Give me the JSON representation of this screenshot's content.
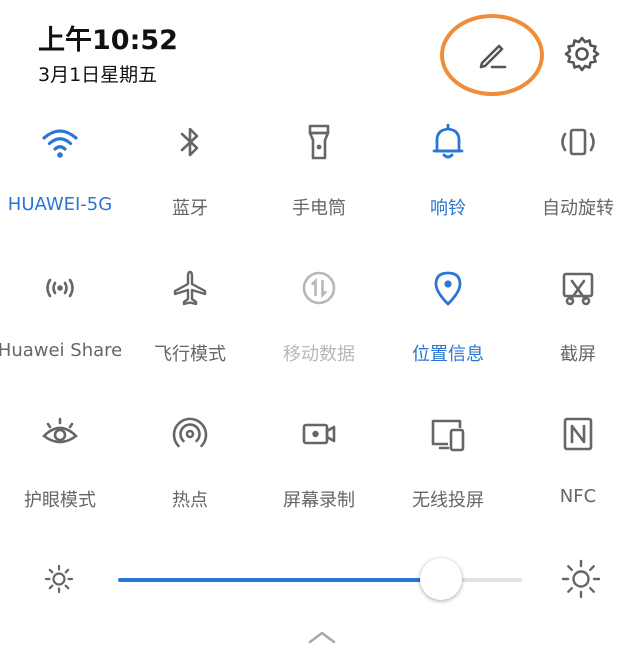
{
  "status": {
    "time": "上午10:52",
    "date": "3月1日星期五"
  },
  "colors": {
    "accent": "#2a76d2",
    "highlight": "#ef8d3b",
    "icon": "#666666",
    "disabled": "#b8b8b8"
  },
  "toggles": [
    {
      "label": "HUAWEI-5G",
      "icon": "wifi-icon",
      "state": "on"
    },
    {
      "label": "蓝牙",
      "icon": "bluetooth-icon",
      "state": "off"
    },
    {
      "label": "手电筒",
      "icon": "flashlight-icon",
      "state": "off"
    },
    {
      "label": "响铃",
      "icon": "bell-icon",
      "state": "on"
    },
    {
      "label": "自动旋转",
      "icon": "auto-rotate-icon",
      "state": "off"
    },
    {
      "label": "Huawei Share",
      "icon": "huawei-share-icon",
      "state": "off"
    },
    {
      "label": "飞行模式",
      "icon": "airplane-icon",
      "state": "off"
    },
    {
      "label": "移动数据",
      "icon": "mobile-data-icon",
      "state": "disabled"
    },
    {
      "label": "位置信息",
      "icon": "location-icon",
      "state": "on"
    },
    {
      "label": "截屏",
      "icon": "screenshot-icon",
      "state": "off"
    },
    {
      "label": "护眼模式",
      "icon": "eye-comfort-icon",
      "state": "off"
    },
    {
      "label": "热点",
      "icon": "hotspot-icon",
      "state": "off"
    },
    {
      "label": "屏幕录制",
      "icon": "screen-record-icon",
      "state": "off"
    },
    {
      "label": "无线投屏",
      "icon": "wireless-projection-icon",
      "state": "off"
    },
    {
      "label": "NFC",
      "icon": "nfc-icon",
      "state": "off"
    }
  ],
  "brightness": {
    "level": 0.8
  }
}
